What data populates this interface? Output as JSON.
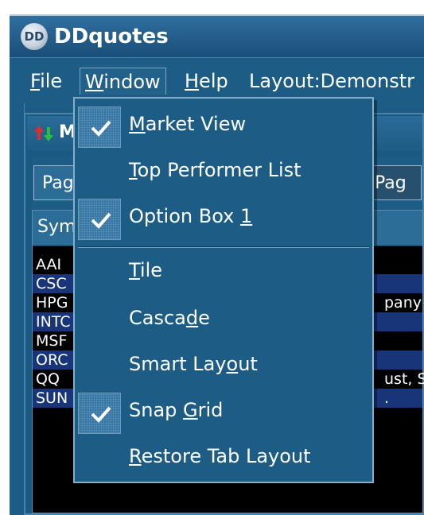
{
  "app": {
    "title": "DDquotes",
    "icon_text": "DD"
  },
  "menubar": {
    "file": {
      "pre": "",
      "key": "F",
      "post": "ile"
    },
    "window": {
      "pre": "",
      "key": "W",
      "post": "indow"
    },
    "help": {
      "pre": "",
      "key": "H",
      "post": "elp"
    },
    "layout": "Layout:Demonstr"
  },
  "subwindow": {
    "title_fragment": "M",
    "tabs": [
      "Pag",
      "Pag"
    ],
    "grid_header": "Sym",
    "rows": [
      {
        "sym": "AAI",
        "desc": ""
      },
      {
        "sym": "CSC",
        "desc": ""
      },
      {
        "sym": "HPG",
        "desc": "pany ("
      },
      {
        "sym": "INTC",
        "desc": ""
      },
      {
        "sym": "MSF",
        "desc": ""
      },
      {
        "sym": "ORC",
        "desc": ""
      },
      {
        "sym": "QQ",
        "desc": "ust, S"
      },
      {
        "sym": "SUN",
        "desc": "."
      }
    ]
  },
  "window_menu": {
    "items": [
      {
        "pre": "",
        "key": "M",
        "post": "arket View",
        "checked": true
      },
      {
        "pre": "",
        "key": "T",
        "post": "op Performer List",
        "checked": false
      },
      {
        "pre": "Option Box ",
        "key": "1",
        "post": "",
        "checked": true
      },
      {
        "pre": "",
        "key": "T",
        "post": "ile",
        "checked": false
      },
      {
        "pre": "Casca",
        "key": "d",
        "post": "e",
        "checked": false
      },
      {
        "pre": "Smart Lay",
        "key": "o",
        "post": "ut",
        "checked": false
      },
      {
        "pre": "Snap ",
        "key": "G",
        "post": "rid",
        "checked": true
      },
      {
        "pre": "",
        "key": "R",
        "post": "estore Tab Layout",
        "checked": false
      }
    ]
  },
  "colors": {
    "menu_bg": "#1d5c84",
    "grid_alt_row": "#18357a",
    "grid_bg": "#000000"
  }
}
